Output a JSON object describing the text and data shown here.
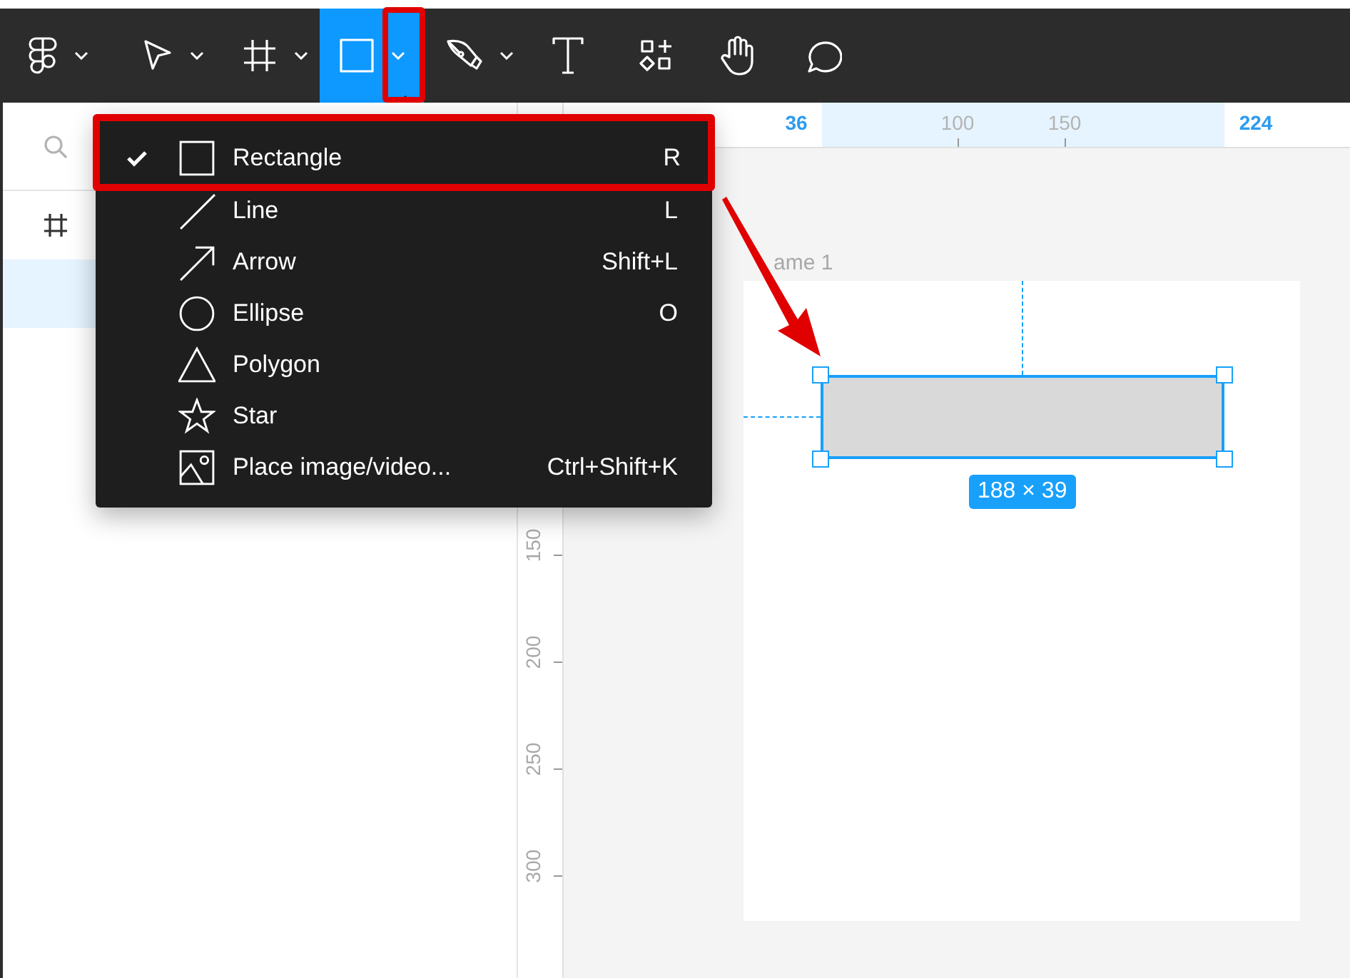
{
  "toolbar": {
    "tools": [
      {
        "kind": "logo",
        "dropdown": true,
        "selected": false
      },
      {
        "kind": "move",
        "dropdown": true,
        "selected": false
      },
      {
        "kind": "frame",
        "dropdown": true,
        "selected": false
      },
      {
        "kind": "rectangle",
        "dropdown": true,
        "selected": true
      },
      {
        "kind": "pen",
        "dropdown": true,
        "selected": false
      },
      {
        "kind": "text",
        "dropdown": false,
        "selected": false
      },
      {
        "kind": "components",
        "dropdown": false,
        "selected": false
      },
      {
        "kind": "hand",
        "dropdown": false,
        "selected": false
      },
      {
        "kind": "comment",
        "dropdown": false,
        "selected": false
      }
    ]
  },
  "layers_panel": {
    "layers": [
      {
        "kind": "frame",
        "selected": false
      },
      {
        "selected": true
      }
    ]
  },
  "rulers": {
    "top": [
      {
        "label": "36",
        "highlighted": true
      },
      {
        "label": "100",
        "highlighted": false
      },
      {
        "label": "150",
        "highlighted": false
      },
      {
        "label": "224",
        "highlighted": true
      }
    ],
    "left": [
      {
        "label": "150"
      },
      {
        "label": "200"
      },
      {
        "label": "250"
      },
      {
        "label": "300"
      }
    ]
  },
  "canvas": {
    "frame": {
      "label": "ame 1"
    },
    "shape": {
      "size": "188 × 39",
      "selected": true
    }
  },
  "shape_menu": {
    "items": [
      {
        "kind": "rectangle",
        "label": "Rectangle",
        "shortcut": "R",
        "checked": true
      },
      {
        "kind": "line",
        "label": "Line",
        "shortcut": "L",
        "checked": false
      },
      {
        "kind": "arrow",
        "label": "Arrow",
        "shortcut": "Shift+L",
        "checked": false
      },
      {
        "kind": "ellipse",
        "label": "Ellipse",
        "shortcut": "O",
        "checked": false
      },
      {
        "kind": "polygon",
        "label": "Polygon",
        "checked": false
      },
      {
        "kind": "star",
        "label": "Star",
        "checked": false
      },
      {
        "kind": "image",
        "label": "Place image/video...",
        "shortcut": "Ctrl+Shift+K",
        "checked": false
      }
    ]
  }
}
